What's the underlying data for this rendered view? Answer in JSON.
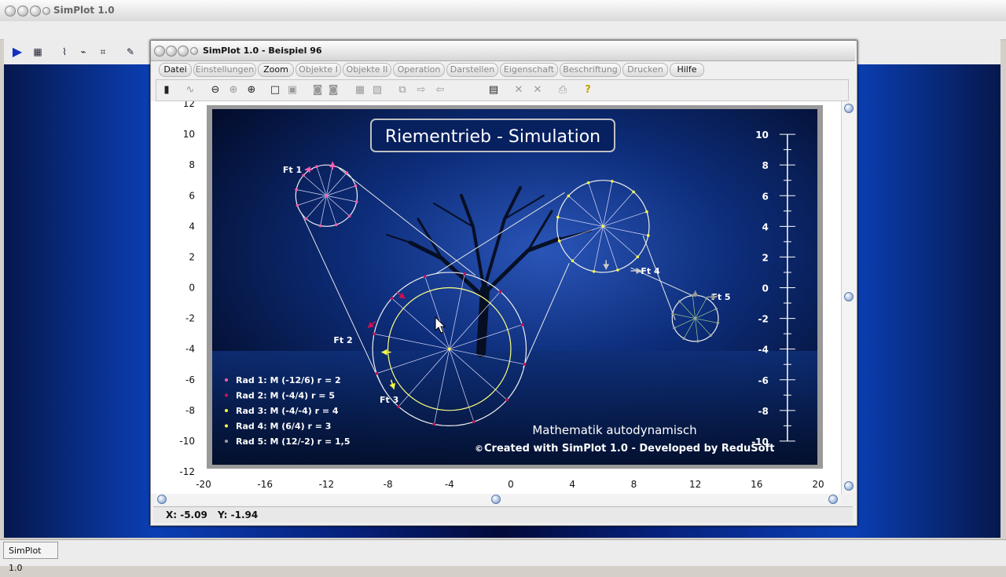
{
  "outer": {
    "title": "SimPlot 1.0",
    "taskbar_item": "SimPlot 1.0"
  },
  "window": {
    "title": "SimPlot 1.0 - Beispiel 96"
  },
  "menu": [
    {
      "label": "Datei",
      "enabled": true
    },
    {
      "label": "Einstellungen",
      "enabled": false
    },
    {
      "label": "Zoom",
      "enabled": true
    },
    {
      "label": "Objekte I",
      "enabled": false
    },
    {
      "label": "Objekte II",
      "enabled": false
    },
    {
      "label": "Operation",
      "enabled": false
    },
    {
      "label": "Darstellen",
      "enabled": false
    },
    {
      "label": "Eigenschaft",
      "enabled": false
    },
    {
      "label": "Beschriftung",
      "enabled": false
    },
    {
      "label": "Drucken",
      "enabled": false
    },
    {
      "label": "Hilfe",
      "enabled": true
    }
  ],
  "status": {
    "x": "X: -5.09",
    "y": "Y: -1.94"
  },
  "colors": {
    "accent": "#0b3fb5",
    "rad1": "#ff5cb0",
    "rad2": "#d01050",
    "rad3": "#ffff40",
    "rad4": "#ffff40",
    "rad5": "#9aa0a0"
  },
  "chart_data": {
    "type": "scatter",
    "title": "Riementrieb - Simulation",
    "xlim": [
      -20,
      20
    ],
    "ylim": [
      -12,
      12
    ],
    "x_ticks": [
      "-20",
      "-16",
      "-12",
      "-8",
      "-4",
      "0",
      "4",
      "8",
      "12",
      "16",
      "20"
    ],
    "y_ticks": [
      "12",
      "10",
      "8",
      "6",
      "4",
      "2",
      "0",
      "-2",
      "-4",
      "-6",
      "-8",
      "-10",
      "-12"
    ],
    "inner_y_ticks": [
      "10",
      "8",
      "6",
      "4",
      "2",
      "0",
      "-2",
      "-4",
      "-6",
      "-8",
      "-10"
    ],
    "wheels": [
      {
        "label": "Rad 1: M (-12/6) r = 2",
        "x": -12,
        "y": 6,
        "r": 2
      },
      {
        "label": "Rad 2: M (-4/4) r = 5",
        "x": -4,
        "y": -4,
        "r": 5
      },
      {
        "label": "Rad 3: M (-4/-4) r = 4",
        "x": -4,
        "y": -4,
        "r": 4
      },
      {
        "label": "Rad 4: M (6/4) r = 3",
        "x": 6,
        "y": 4,
        "r": 3
      },
      {
        "label": "Rad 5: M (12/-2) r = 1,5",
        "x": 12,
        "y": -2,
        "r": 1.5
      }
    ],
    "forces": [
      {
        "label": "Ft 1",
        "x": -13.4,
        "y": 7.7
      },
      {
        "label": "Ft 2",
        "x": -10.1,
        "y": -3.4
      },
      {
        "label": "Ft 3",
        "x": -7.1,
        "y": -7.3
      },
      {
        "label": "Ft 4",
        "x": 9.9,
        "y": 1.1
      },
      {
        "label": "Ft 5",
        "x": 14.5,
        "y": -0.6
      }
    ],
    "footer_line1": "Mathematik autodynamisch",
    "footer_line2": "Created with SimPlot 1.0 - Developed by ReduSoft",
    "copyright_symbol": "©"
  }
}
